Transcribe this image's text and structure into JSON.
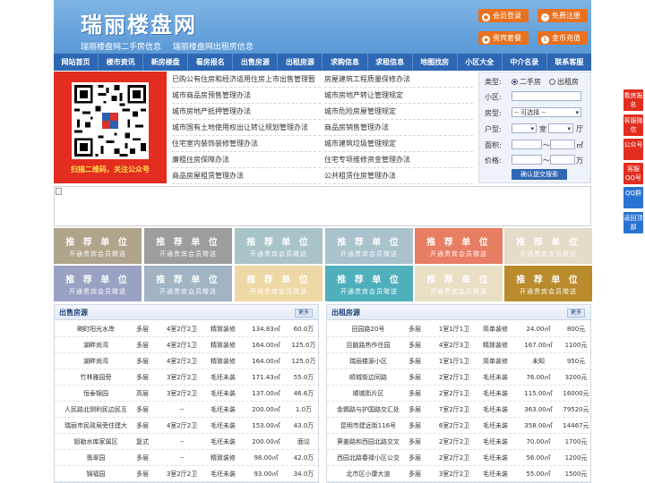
{
  "header": {
    "logo": "瑞丽楼盘网",
    "sublinks": [
      "瑞丽楼盘网二手房信息",
      "瑞丽楼盘网出租房信息"
    ],
    "buttons": [
      {
        "label": "会员登录",
        "icon": "user-icon"
      },
      {
        "label": "免费注册",
        "icon": "plus-icon"
      },
      {
        "label": "贵宾套餐",
        "icon": "diamond-icon"
      },
      {
        "label": "金币充值",
        "icon": "coin-icon"
      }
    ]
  },
  "nav": [
    "网站首页",
    "楼市资讯",
    "新房楼盘",
    "看房报名",
    "出售房源",
    "出租房源",
    "求购信息",
    "求租信息",
    "地图找房",
    "小区大全",
    "中介名录",
    "联系客服"
  ],
  "qr": {
    "caption": "扫描二维码，关注公众号"
  },
  "notices": {
    "left": [
      "已购公有住房和经济适用住房上市出售管理暂",
      "城市商品房预售管理办法",
      "城市房地产抵押管理办法",
      "城市国有土地使用权出让转让规划管理办法",
      "住宅室内装饰装修管理办法",
      "廉租住房保障办法",
      "商品房屋租赁管理办法"
    ],
    "right": [
      "房屋建筑工程质量保修办法",
      "城市房地产转让管理规定",
      "城市危险房屋管理规定",
      "商品房销售管理办法",
      "城市建筑垃圾管理规定",
      "住宅专项维修资金管理办法",
      "公共租赁住房管理办法"
    ]
  },
  "search": {
    "type_label": "类型:",
    "type_options": [
      "二手房",
      "出租房"
    ],
    "community_label": "小区:",
    "house_label": "房型:",
    "house_value": "-- 可选择 --",
    "layout_label": "户型:",
    "room_unit": "室",
    "hall_unit": "厅",
    "area_label": "面积:",
    "price_label": "价格:",
    "range_sep": "～",
    "area_unit": "㎡",
    "price_unit": "万",
    "submit_label": "确认提交搜索"
  },
  "recommend": {
    "title": "推 荐 单 位",
    "subtitle": "开通贵宾会员赠送",
    "colors": [
      "#b0a48a",
      "#9d9d9d",
      "#a8c4c8",
      "#a9c2cc",
      "#e77d62",
      "#e3dcc8",
      "#9aa2c4",
      "#a2b3c3",
      "#eed8a5",
      "#4fb0bc",
      "#e8dfc5",
      "#b98b2c"
    ]
  },
  "sale": {
    "title": "出售房源",
    "more": "更多",
    "rows": [
      [
        "畹町阳光水岸",
        "多层",
        "4室2厅2卫",
        "精致装修",
        "134.83㎡",
        "60.0万"
      ],
      [
        "湖畔尚湾",
        "多层",
        "4室2厅1卫",
        "精致装修",
        "164.00㎡",
        "125.0万"
      ],
      [
        "湖畔尚湾",
        "多层",
        "4室2厅2卫",
        "精致装修",
        "164.00㎡",
        "125.0万"
      ],
      [
        "竹林雅园旁",
        "多层",
        "3室2厅2卫",
        "毛坯未装",
        "171.43㎡",
        "55.0万"
      ],
      [
        "恒泰锦园",
        "高层",
        "3室2厅2卫",
        "毛坯未装",
        "137.00㎡",
        "46.6万"
      ],
      [
        "人民路北侧利民边民互",
        "多层",
        "--",
        "毛坯未装",
        "200.00㎡",
        "1.0万"
      ],
      [
        "瑞丽市民政局旁住建大",
        "多层",
        "4室2厅2卫",
        "毛坯未装",
        "153.00㎡",
        "43.0万"
      ],
      [
        "姐勒水库家属区",
        "复式",
        "--",
        "毛坯未装",
        "200.00㎡",
        "面议"
      ],
      [
        "翡翠园",
        "多层",
        "--",
        "精致装修",
        "98.00㎡",
        "42.0万"
      ],
      [
        "锦福园",
        "多层",
        "3室2厅2卫",
        "毛坯未装",
        "93.00㎡",
        "34.0万"
      ]
    ]
  },
  "rent": {
    "title": "出租房源",
    "more": "更多",
    "rows": [
      [
        "田园路20号",
        "多层",
        "1室1厅1卫",
        "简单装修",
        "24.00㎡",
        "800元"
      ],
      [
        "目脑路热作住园",
        "多层",
        "4室2厅3卫",
        "精致装修",
        "167.00㎡",
        "1100元"
      ],
      [
        "瑞丽楼源小区",
        "多层",
        "1室1厅1卫",
        "简单装修",
        "未知",
        "950元"
      ],
      [
        "顺城街边同路",
        "多层",
        "2室2厅1卫",
        "毛坯未装",
        "76.00㎡",
        "3200元"
      ],
      [
        "顺城街片区",
        "多层",
        "2室2厅1卫",
        "毛坯未装",
        "115.00㎡",
        "16000元"
      ],
      [
        "金鹦路与护国路交汇处",
        "多层",
        "7室2厅2卫",
        "毛坯未装",
        "363.00㎡",
        "79520元"
      ],
      [
        "昆明市建远街116号",
        "多层",
        "6室2厅2卫",
        "毛坯未装",
        "358.00㎡",
        "14467元"
      ],
      [
        "葵姜路和西园北路交叉",
        "多层",
        "2室2厅2卫",
        "毛坯未装",
        "70.00㎡",
        "1700元"
      ],
      [
        "西园北路春禄小区公交",
        "多层",
        "2室2厅2卫",
        "毛坯未装",
        "56.00㎡",
        "1200元"
      ],
      [
        "北市区小康大道",
        "多层",
        "3室2厅2卫",
        "毛坯未装",
        "55.00㎡",
        "1500元"
      ]
    ]
  },
  "float": [
    {
      "label": "看房报名",
      "color": "red"
    },
    {
      "label": "客服微信",
      "color": "red"
    },
    {
      "label": "公众号",
      "color": "red"
    },
    {
      "label": "客服QQ号",
      "color": "red"
    },
    {
      "label": "QQ群",
      "color": "blue"
    },
    {
      "label": "返回顶部",
      "color": "blue"
    }
  ]
}
